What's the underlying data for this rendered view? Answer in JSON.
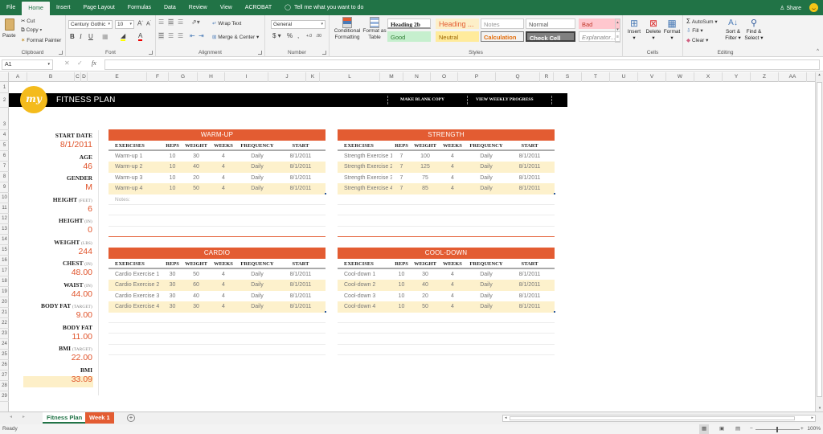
{
  "ribbon_tabs": [
    "File",
    "Home",
    "Insert",
    "Page Layout",
    "Formulas",
    "Data",
    "Review",
    "View",
    "ACROBAT"
  ],
  "active_tab": "Home",
  "tell_me": "Tell me what you want to do",
  "share_label": "Share",
  "clipboard": {
    "paste": "Paste",
    "cut": "Cut",
    "copy": "Copy",
    "format_painter": "Format Painter",
    "label": "Clipboard"
  },
  "font": {
    "family": "Century Gothic",
    "size": "10",
    "label": "Font",
    "bold": "B",
    "italic": "I",
    "underline": "U"
  },
  "alignment": {
    "wrap_text": "Wrap Text",
    "merge_center": "Merge & Center",
    "label": "Alignment"
  },
  "number": {
    "format": "General",
    "currency": "$",
    "percent": "%",
    "comma": ",",
    "label": "Number"
  },
  "styles": {
    "conditional_formatting": "Conditional Formatting",
    "format_as_table": "Format as Table",
    "cells": [
      {
        "name": "Heading 2b",
        "bg": "#ffffff",
        "color": "#222222"
      },
      {
        "name": "Heading ...",
        "bg": "#fdefc8",
        "color": "#e35c32"
      },
      {
        "name": "Notes",
        "bg": "#ffffff",
        "color": "#999999"
      },
      {
        "name": "Normal",
        "bg": "#ffffff",
        "color": "#555555"
      },
      {
        "name": "Bad",
        "bg": "#ffc7ce",
        "color": "#c0392b"
      },
      {
        "name": "Good",
        "bg": "#c6efce",
        "color": "#2e7d32"
      },
      {
        "name": "Neutral",
        "bg": "#ffeb9c",
        "color": "#9c6500"
      },
      {
        "name": "Calculation",
        "bg": "#f2f2f2",
        "color": "#e36c09"
      },
      {
        "name": "Check Cell",
        "bg": "#808080",
        "color": "#ffffff"
      },
      {
        "name": "Explanator...",
        "bg": "#ffffff",
        "color": "#888888"
      }
    ],
    "label": "Styles"
  },
  "cells_group": {
    "insert": "Insert",
    "delete": "Delete",
    "format": "Format",
    "label": "Cells"
  },
  "editing": {
    "autosum": "AutoSum",
    "fill": "Fill",
    "clear": "Clear",
    "sort_filter": "Sort & Filter",
    "find_select": "Find & Select",
    "label": "Editing"
  },
  "formula_bar": {
    "name_box": "A1",
    "formula": ""
  },
  "columns": [
    "A",
    "B",
    "C",
    "D",
    "E",
    "F",
    "G",
    "H",
    "I",
    "J",
    "K",
    "L",
    "M",
    "N",
    "O",
    "P",
    "Q",
    "R",
    "S",
    "T",
    "U",
    "V",
    "W",
    "X",
    "Y",
    "Z",
    "AA"
  ],
  "rows": [
    "1",
    "2",
    "3",
    "4",
    "5",
    "6",
    "7",
    "8",
    "9",
    "10",
    "11",
    "12",
    "13",
    "14",
    "15",
    "16",
    "17",
    "18",
    "19",
    "20",
    "21",
    "22",
    "23",
    "24",
    "25",
    "26",
    "27",
    "28",
    "29"
  ],
  "banner": {
    "logo": "my",
    "title": "FITNESS PLAN",
    "make_copy": "MAKE BLANK COPY",
    "view_progress": "VIEW WEEKLY PROGRESS"
  },
  "profile": [
    {
      "label": "START DATE",
      "unit": "",
      "value": "8/1/2011"
    },
    {
      "label": "AGE",
      "unit": "",
      "value": "46"
    },
    {
      "label": "GENDER",
      "unit": "",
      "value": "M"
    },
    {
      "label": "HEIGHT",
      "unit": "(FEET)",
      "value": "6"
    },
    {
      "label": "HEIGHT",
      "unit": "(IN)",
      "value": "0"
    },
    {
      "label": "WEIGHT",
      "unit": "(LBS)",
      "value": "244"
    },
    {
      "label": "CHEST",
      "unit": "(IN)",
      "value": "48.00"
    },
    {
      "label": "WAIST",
      "unit": "(IN)",
      "value": "44.00"
    },
    {
      "label": "BODY FAT",
      "unit": "(TARGET)",
      "value": "9.00"
    },
    {
      "label": "BODY FAT",
      "unit": "",
      "value": "11.00"
    },
    {
      "label": "BMI",
      "unit": "(TARGET)",
      "value": "22.00"
    },
    {
      "label": "BMI",
      "unit": "",
      "value": "33.09"
    }
  ],
  "table_headers": [
    "EXERCISES",
    "REPS",
    "WEIGHT",
    "WEEKS",
    "FREQUENCY",
    "START"
  ],
  "notes_label": "Notes:",
  "tables": {
    "warmup": {
      "title": "WARM-UP",
      "rows": [
        [
          "Warm-up 1",
          "10",
          "30",
          "4",
          "Daily",
          "8/1/2011"
        ],
        [
          "Warm-up 2",
          "10",
          "40",
          "4",
          "Daily",
          "8/1/2011"
        ],
        [
          "Warm-up 3",
          "10",
          "20",
          "4",
          "Daily",
          "8/1/2011"
        ],
        [
          "Warm-up 4",
          "10",
          "50",
          "4",
          "Daily",
          "8/1/2011"
        ]
      ]
    },
    "strength": {
      "title": "STRENGTH",
      "rows": [
        [
          "Strength Exercise 1",
          "7",
          "100",
          "4",
          "Daily",
          "8/1/2011"
        ],
        [
          "Strength Exercise 2",
          "7",
          "125",
          "4",
          "Daily",
          "8/1/2011"
        ],
        [
          "Strength Exercise 3",
          "7",
          "75",
          "4",
          "Daily",
          "8/1/2011"
        ],
        [
          "Strength Exercise 4",
          "7",
          "85",
          "4",
          "Daily",
          "8/1/2011"
        ]
      ]
    },
    "cardio": {
      "title": "CARDIO",
      "rows": [
        [
          "Cardio Exercise 1",
          "30",
          "50",
          "4",
          "Daily",
          "8/1/2011"
        ],
        [
          "Cardio Exercise 2",
          "30",
          "60",
          "4",
          "Daily",
          "8/1/2011"
        ],
        [
          "Cardio Exercise 3",
          "30",
          "40",
          "4",
          "Daily",
          "8/1/2011"
        ],
        [
          "Cardio Exercise 4",
          "30",
          "30",
          "4",
          "Daily",
          "8/1/2011"
        ]
      ]
    },
    "cooldown": {
      "title": "COOL-DOWN",
      "rows": [
        [
          "Cool-down 1",
          "10",
          "30",
          "4",
          "Daily",
          "8/1/2011"
        ],
        [
          "Cool-down 2",
          "10",
          "40",
          "4",
          "Daily",
          "8/1/2011"
        ],
        [
          "Cool-down 3",
          "10",
          "20",
          "4",
          "Daily",
          "8/1/2011"
        ],
        [
          "Cool-down 4",
          "10",
          "50",
          "4",
          "Daily",
          "8/1/2011"
        ]
      ]
    }
  },
  "sheet_tabs": [
    {
      "name": "Fitness Plan",
      "active": true
    },
    {
      "name": "Week 1",
      "active": false
    }
  ],
  "status": {
    "text": "Ready",
    "zoom": "100%"
  },
  "colors": {
    "accent": "#e35c32",
    "excel_green": "#217346",
    "logo_yellow": "#f4bb1c",
    "alt_row": "#fdf1cc"
  }
}
